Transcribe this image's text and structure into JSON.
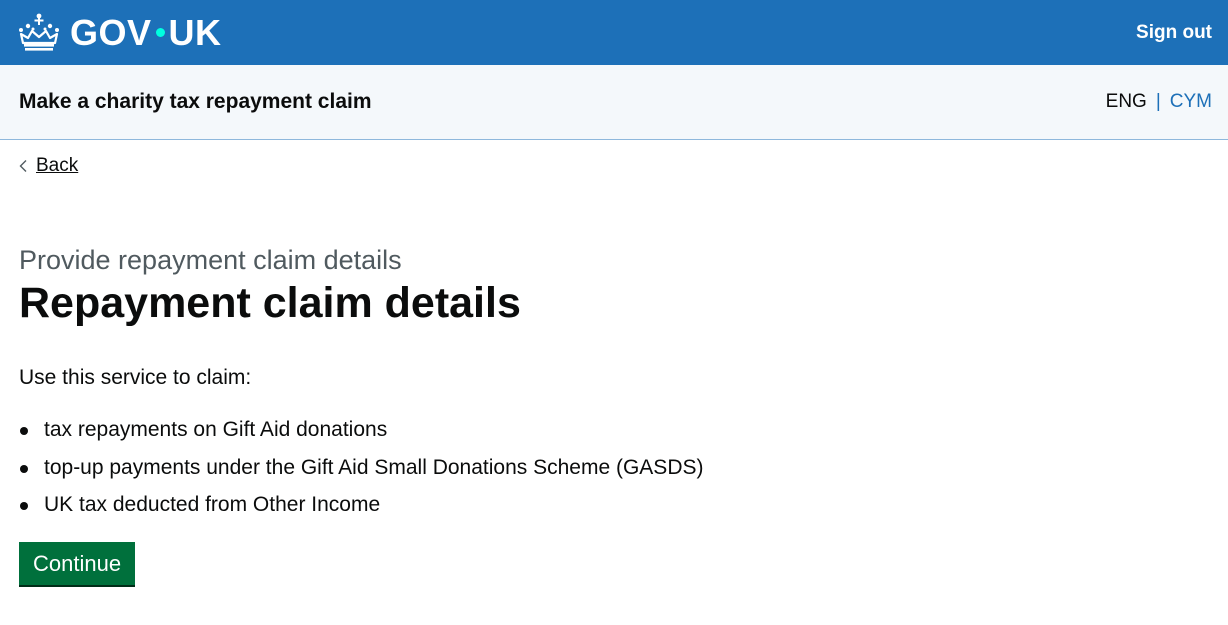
{
  "header": {
    "logo_text_left": "GOV",
    "logo_text_right": "UK",
    "sign_out_label": "Sign out",
    "brand_color": "#1d70b8"
  },
  "service": {
    "name": "Make a charity tax repayment claim",
    "lang_current": "ENG",
    "lang_separator": "|",
    "lang_other": "CYM"
  },
  "main": {
    "back_label": "Back",
    "caption": "Provide repayment claim details",
    "heading": "Repayment claim details",
    "intro": "Use this service to claim:",
    "bullets": [
      "tax repayments on Gift Aid donations",
      "top-up payments under the Gift Aid Small Donations Scheme (GASDS)",
      "UK tax deducted from Other Income"
    ],
    "continue_label": "Continue",
    "button_color": "#00703c"
  }
}
